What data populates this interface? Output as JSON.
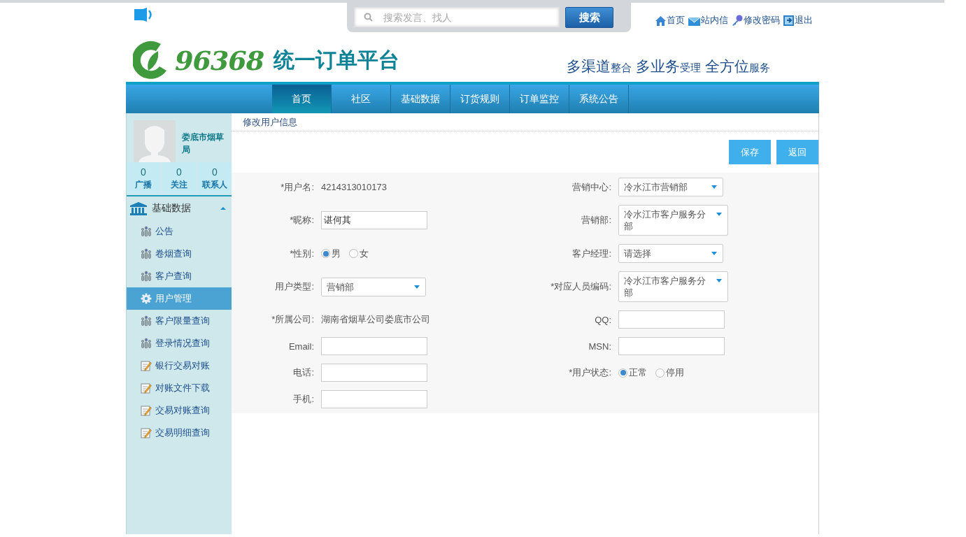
{
  "header": {
    "search": {
      "placeholder": "搜索发言、找人",
      "button": "搜索"
    },
    "links": [
      {
        "label": "首页"
      },
      {
        "label": "站内信"
      },
      {
        "label": "修改密码"
      },
      {
        "label": "退出"
      }
    ],
    "logo": {
      "number": "96368",
      "name": "统一订单平台"
    },
    "slogan": [
      {
        "text": "多渠道",
        "emphasis": true
      },
      {
        "text": "整合",
        "emphasis": false
      },
      {
        "text": " 多业务",
        "emphasis": true
      },
      {
        "text": "受理",
        "emphasis": false
      },
      {
        "text": " 全方位",
        "emphasis": true
      },
      {
        "text": "服务",
        "emphasis": false
      }
    ]
  },
  "nav": [
    {
      "label": "首页",
      "selected": true
    },
    {
      "label": "社区",
      "selected": false
    },
    {
      "label": "基础数据",
      "selected": false
    },
    {
      "label": "订货规则",
      "selected": false
    },
    {
      "label": "订单监控",
      "selected": false
    },
    {
      "label": "系统公告",
      "selected": false
    }
  ],
  "sidebar": {
    "profile": {
      "name": "娄底市烟草局",
      "stats": [
        {
          "value": "0",
          "label": "广播"
        },
        {
          "value": "0",
          "label": "关注"
        },
        {
          "value": "0",
          "label": "联系人"
        }
      ]
    },
    "section": {
      "title": "基础数据",
      "expanded": true
    },
    "items": [
      {
        "label": "公告",
        "kind": "people",
        "selected": false
      },
      {
        "label": "卷烟查询",
        "kind": "people",
        "selected": false
      },
      {
        "label": "客户查询",
        "kind": "people",
        "selected": false
      },
      {
        "label": "用户管理",
        "kind": "gear",
        "selected": true
      },
      {
        "label": "客户限量查询",
        "kind": "people",
        "selected": false
      },
      {
        "label": "登录情况查询",
        "kind": "people",
        "selected": false
      },
      {
        "label": "银行交易对账",
        "kind": "note",
        "selected": false
      },
      {
        "label": "对账文件下载",
        "kind": "note",
        "selected": false
      },
      {
        "label": "交易对账查询",
        "kind": "note",
        "selected": false
      },
      {
        "label": "交易明细查询",
        "kind": "note",
        "selected": false
      }
    ]
  },
  "main": {
    "title": "修改用户信息",
    "buttons": [
      "保存",
      "返回"
    ],
    "rows": [
      [
        {
          "label": "*用户名:",
          "kind": "text",
          "value": "4214313010173"
        },
        {
          "label": "营销中心:",
          "kind": "select",
          "value": "冷水江市营销部"
        }
      ],
      [
        {
          "label": "*昵称:",
          "kind": "input",
          "value": "谌何其"
        },
        {
          "label": "营销部:",
          "kind": "select",
          "value": "冷水江市客户服务分部"
        }
      ],
      [
        {
          "label": "*性别:",
          "kind": "radio",
          "options": [
            {
              "label": "男",
              "selected": true
            },
            {
              "label": "女",
              "selected": false
            }
          ]
        },
        {
          "label": "客户经理:",
          "kind": "select",
          "value": "请选择"
        }
      ],
      [
        {
          "label": "用户类型:",
          "kind": "select",
          "value": "营销部"
        },
        {
          "label": "*对应人员编码:",
          "kind": "select",
          "value": "冷水江市客户服务分部"
        }
      ],
      [
        {
          "label": "*所属公司:",
          "kind": "text",
          "value": "湖南省烟草公司娄底市公司"
        },
        {
          "label": "QQ:",
          "kind": "input"
        }
      ],
      [
        {
          "label": "Email:",
          "kind": "input"
        },
        {
          "label": "MSN:",
          "kind": "input"
        }
      ],
      [
        {
          "label": "电话:",
          "kind": "input"
        },
        {
          "label": "*用户状态:",
          "kind": "radio",
          "options": [
            {
              "label": "正常",
              "selected": true
            },
            {
              "label": "停用",
              "selected": false
            }
          ]
        }
      ],
      [
        {
          "label": "手机:",
          "kind": "input"
        }
      ]
    ]
  }
}
